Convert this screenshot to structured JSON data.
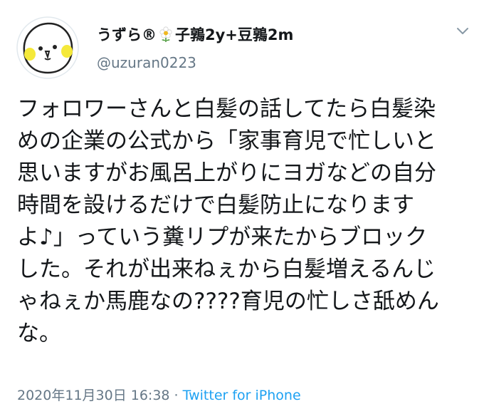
{
  "user": {
    "name_prefix": "うずら®",
    "name_suffix": "子鶉2y+豆鶉2m",
    "handle": "@uzuran0223",
    "avatar_icon": "quail-avatar-icon",
    "name_icon": "flower-icon"
  },
  "menu": {
    "icon": "chevron-down-icon"
  },
  "tweet": {
    "lines": [
      "フォロワーさんと白髪の話してたら白髪染",
      "めの企業の公式から「家事育児で忙しいと",
      "思いますがお風呂上がりにヨガなどの自分",
      "時間を設けるだけで白髪防止になります",
      "よ♪」っていう糞リプが来たからブロック",
      "した。それが出来ねぇから白髪増えるんじ",
      "ゃねぇか馬鹿なの????育児の忙しさ舐めん",
      "な。"
    ]
  },
  "meta": {
    "timestamp": "2020年11月30日 16:38",
    "separator": " · ",
    "source": "Twitter for iPhone"
  },
  "colors": {
    "text": "#14171a",
    "secondary": "#657786",
    "link": "#1da1f2",
    "avatar_cheek": "#f5e93a"
  }
}
